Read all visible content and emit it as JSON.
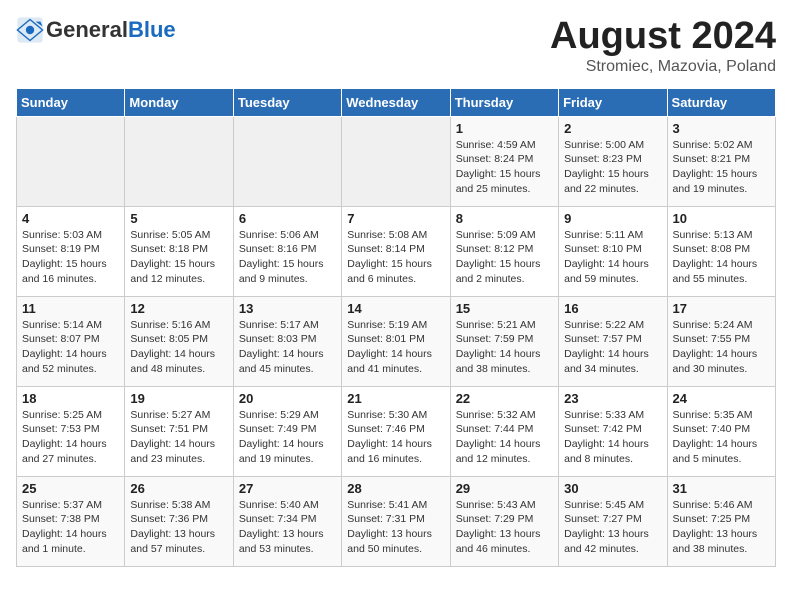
{
  "header": {
    "logo_general": "General",
    "logo_blue": "Blue",
    "month_title": "August 2024",
    "subtitle": "Stromiec, Mazovia, Poland"
  },
  "weekdays": [
    "Sunday",
    "Monday",
    "Tuesday",
    "Wednesday",
    "Thursday",
    "Friday",
    "Saturday"
  ],
  "weeks": [
    [
      {
        "day": "",
        "info": ""
      },
      {
        "day": "",
        "info": ""
      },
      {
        "day": "",
        "info": ""
      },
      {
        "day": "",
        "info": ""
      },
      {
        "day": "1",
        "info": "Sunrise: 4:59 AM\nSunset: 8:24 PM\nDaylight: 15 hours\nand 25 minutes."
      },
      {
        "day": "2",
        "info": "Sunrise: 5:00 AM\nSunset: 8:23 PM\nDaylight: 15 hours\nand 22 minutes."
      },
      {
        "day": "3",
        "info": "Sunrise: 5:02 AM\nSunset: 8:21 PM\nDaylight: 15 hours\nand 19 minutes."
      }
    ],
    [
      {
        "day": "4",
        "info": "Sunrise: 5:03 AM\nSunset: 8:19 PM\nDaylight: 15 hours\nand 16 minutes."
      },
      {
        "day": "5",
        "info": "Sunrise: 5:05 AM\nSunset: 8:18 PM\nDaylight: 15 hours\nand 12 minutes."
      },
      {
        "day": "6",
        "info": "Sunrise: 5:06 AM\nSunset: 8:16 PM\nDaylight: 15 hours\nand 9 minutes."
      },
      {
        "day": "7",
        "info": "Sunrise: 5:08 AM\nSunset: 8:14 PM\nDaylight: 15 hours\nand 6 minutes."
      },
      {
        "day": "8",
        "info": "Sunrise: 5:09 AM\nSunset: 8:12 PM\nDaylight: 15 hours\nand 2 minutes."
      },
      {
        "day": "9",
        "info": "Sunrise: 5:11 AM\nSunset: 8:10 PM\nDaylight: 14 hours\nand 59 minutes."
      },
      {
        "day": "10",
        "info": "Sunrise: 5:13 AM\nSunset: 8:08 PM\nDaylight: 14 hours\nand 55 minutes."
      }
    ],
    [
      {
        "day": "11",
        "info": "Sunrise: 5:14 AM\nSunset: 8:07 PM\nDaylight: 14 hours\nand 52 minutes."
      },
      {
        "day": "12",
        "info": "Sunrise: 5:16 AM\nSunset: 8:05 PM\nDaylight: 14 hours\nand 48 minutes."
      },
      {
        "day": "13",
        "info": "Sunrise: 5:17 AM\nSunset: 8:03 PM\nDaylight: 14 hours\nand 45 minutes."
      },
      {
        "day": "14",
        "info": "Sunrise: 5:19 AM\nSunset: 8:01 PM\nDaylight: 14 hours\nand 41 minutes."
      },
      {
        "day": "15",
        "info": "Sunrise: 5:21 AM\nSunset: 7:59 PM\nDaylight: 14 hours\nand 38 minutes."
      },
      {
        "day": "16",
        "info": "Sunrise: 5:22 AM\nSunset: 7:57 PM\nDaylight: 14 hours\nand 34 minutes."
      },
      {
        "day": "17",
        "info": "Sunrise: 5:24 AM\nSunset: 7:55 PM\nDaylight: 14 hours\nand 30 minutes."
      }
    ],
    [
      {
        "day": "18",
        "info": "Sunrise: 5:25 AM\nSunset: 7:53 PM\nDaylight: 14 hours\nand 27 minutes."
      },
      {
        "day": "19",
        "info": "Sunrise: 5:27 AM\nSunset: 7:51 PM\nDaylight: 14 hours\nand 23 minutes."
      },
      {
        "day": "20",
        "info": "Sunrise: 5:29 AM\nSunset: 7:49 PM\nDaylight: 14 hours\nand 19 minutes."
      },
      {
        "day": "21",
        "info": "Sunrise: 5:30 AM\nSunset: 7:46 PM\nDaylight: 14 hours\nand 16 minutes."
      },
      {
        "day": "22",
        "info": "Sunrise: 5:32 AM\nSunset: 7:44 PM\nDaylight: 14 hours\nand 12 minutes."
      },
      {
        "day": "23",
        "info": "Sunrise: 5:33 AM\nSunset: 7:42 PM\nDaylight: 14 hours\nand 8 minutes."
      },
      {
        "day": "24",
        "info": "Sunrise: 5:35 AM\nSunset: 7:40 PM\nDaylight: 14 hours\nand 5 minutes."
      }
    ],
    [
      {
        "day": "25",
        "info": "Sunrise: 5:37 AM\nSunset: 7:38 PM\nDaylight: 14 hours\nand 1 minute."
      },
      {
        "day": "26",
        "info": "Sunrise: 5:38 AM\nSunset: 7:36 PM\nDaylight: 13 hours\nand 57 minutes."
      },
      {
        "day": "27",
        "info": "Sunrise: 5:40 AM\nSunset: 7:34 PM\nDaylight: 13 hours\nand 53 minutes."
      },
      {
        "day": "28",
        "info": "Sunrise: 5:41 AM\nSunset: 7:31 PM\nDaylight: 13 hours\nand 50 minutes."
      },
      {
        "day": "29",
        "info": "Sunrise: 5:43 AM\nSunset: 7:29 PM\nDaylight: 13 hours\nand 46 minutes."
      },
      {
        "day": "30",
        "info": "Sunrise: 5:45 AM\nSunset: 7:27 PM\nDaylight: 13 hours\nand 42 minutes."
      },
      {
        "day": "31",
        "info": "Sunrise: 5:46 AM\nSunset: 7:25 PM\nDaylight: 13 hours\nand 38 minutes."
      }
    ]
  ]
}
